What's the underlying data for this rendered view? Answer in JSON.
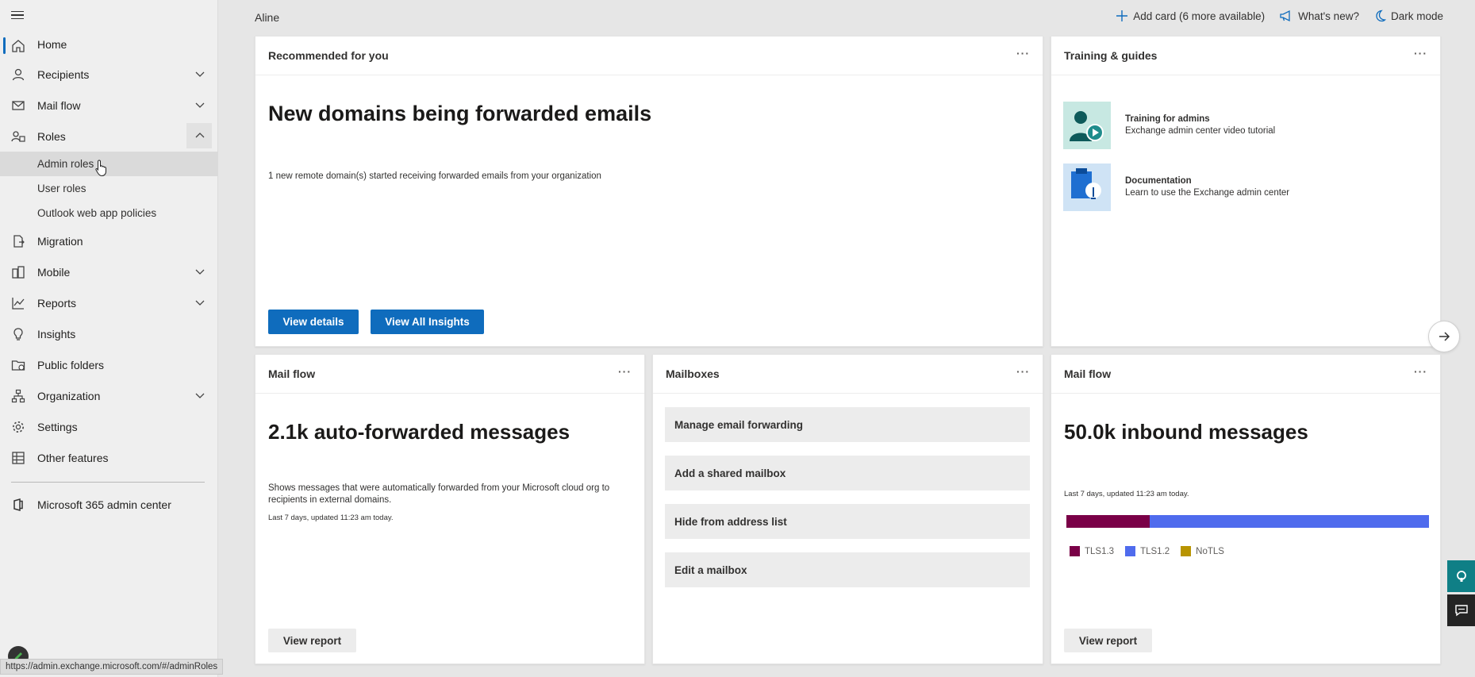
{
  "sidebar": {
    "items": [
      {
        "label": "Home",
        "icon": "home-icon"
      },
      {
        "label": "Recipients",
        "icon": "person-icon"
      },
      {
        "label": "Mail flow",
        "icon": "mail-icon"
      },
      {
        "label": "Roles",
        "icon": "roles-icon"
      },
      {
        "label": "Migration",
        "icon": "migration-icon"
      },
      {
        "label": "Mobile",
        "icon": "mobile-icon"
      },
      {
        "label": "Reports",
        "icon": "chart-icon"
      },
      {
        "label": "Insights",
        "icon": "lightbulb-icon"
      },
      {
        "label": "Public folders",
        "icon": "folder-icon"
      },
      {
        "label": "Organization",
        "icon": "org-icon"
      },
      {
        "label": "Settings",
        "icon": "gear-icon"
      },
      {
        "label": "Other features",
        "icon": "grid-icon"
      }
    ],
    "roles_sub": [
      "Admin roles",
      "User roles",
      "Outlook web app policies"
    ],
    "footer_link": "Microsoft 365 admin center",
    "active_item": "Home",
    "selected_sub": "Admin roles"
  },
  "topbar": {
    "user": "Aline",
    "add_card": "Add card (6 more available)",
    "whats_new": "What's new?",
    "dark_mode": "Dark mode"
  },
  "cards": {
    "recommended": {
      "header": "Recommended for you",
      "title": "New domains being forwarded emails",
      "description": "1 new remote domain(s) started receiving forwarded emails from your organization",
      "btn_details": "View details",
      "btn_insights": "View All Insights"
    },
    "training": {
      "header": "Training & guides",
      "items": [
        {
          "title": "Training for admins",
          "subtitle": "Exchange admin center video tutorial"
        },
        {
          "title": "Documentation",
          "subtitle": "Learn to use the Exchange admin center"
        }
      ]
    },
    "mailflow_forward": {
      "header": "Mail flow",
      "title": "2.1k auto-forwarded messages",
      "description": "Shows messages that were automatically forwarded from your Microsoft cloud org to recipients in external domains.",
      "updated": "Last 7 days, updated 11:23 am today.",
      "button": "View report"
    },
    "mailboxes": {
      "header": "Mailboxes",
      "actions": [
        "Manage email forwarding",
        "Add a shared mailbox",
        "Hide from address list",
        "Edit a mailbox"
      ]
    },
    "mailflow_inbound": {
      "header": "Mail flow",
      "title": "50.0k inbound messages",
      "updated": "Last 7 days, updated 11:23 am today.",
      "button": "View report",
      "bar": [
        {
          "name": "TLS1.3",
          "share": 0.23,
          "color": "#7a0047"
        },
        {
          "name": "TLS1.2",
          "share": 0.77,
          "color": "#4f6bed"
        },
        {
          "name": "NoTLS",
          "share": 0.0,
          "color": "#b89400"
        }
      ]
    }
  },
  "more_label": "···",
  "statusbar": {
    "url": "https://admin.exchange.microsoft.com/#/adminRoles"
  }
}
